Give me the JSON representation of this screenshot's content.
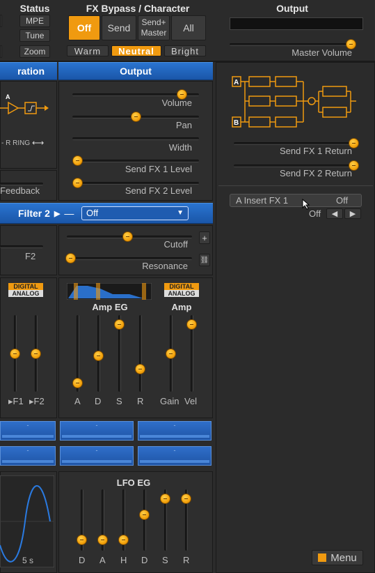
{
  "status": {
    "title": "Status",
    "mpe": "MPE",
    "tune": "Tune",
    "zoom": "Zoom"
  },
  "fxbypass": {
    "title": "FX Bypass / Character",
    "off": "Off",
    "send": "Send",
    "send_master": "Send+\nMaster",
    "all": "All",
    "warm": "Warm",
    "neutral": "Neutral",
    "bright": "Bright"
  },
  "output_top": {
    "title": "Output",
    "master_volume": "Master Volume"
  },
  "bars": {
    "left": "ration",
    "middle": "Output"
  },
  "left_col": {
    "ring_label": "- R RING",
    "feedback": "Feedback",
    "f2": "F2"
  },
  "output_mid": {
    "volume": "Volume",
    "pan": "Pan",
    "width": "Width",
    "send1": "Send FX 1 Level",
    "send2": "Send FX 2 Level"
  },
  "filter2": {
    "label": "Filter 2",
    "select_value": "Off",
    "cutoff": "Cutoff",
    "resonance": "Resonance"
  },
  "right_panel": {
    "send1_return": "Send FX 1 Return",
    "send2_return": "Send FX 2 Return",
    "insert_label": "A Insert FX 1",
    "insert_value": "Off",
    "off_label": "Off"
  },
  "badges": {
    "digital": "DIGITAL",
    "analog": "ANALOG"
  },
  "amp_eg": {
    "title": "Amp EG",
    "labels": [
      "A",
      "D",
      "S",
      "R"
    ],
    "amp_title": "Amp",
    "gain": "Gain",
    "vel": "Vel",
    "f1": "F1",
    "f2": "F2"
  },
  "lfo_eg": {
    "title": "LFO EG",
    "labels": [
      "D",
      "A",
      "H",
      "D",
      "S",
      "R"
    ],
    "time": "5 s"
  },
  "menu": {
    "label": "Menu"
  },
  "cells": [
    "-",
    "-",
    "-",
    "-",
    "-",
    "-"
  ],
  "colors": {
    "accent": "#f09a10",
    "blue": "#1f5cb0"
  }
}
